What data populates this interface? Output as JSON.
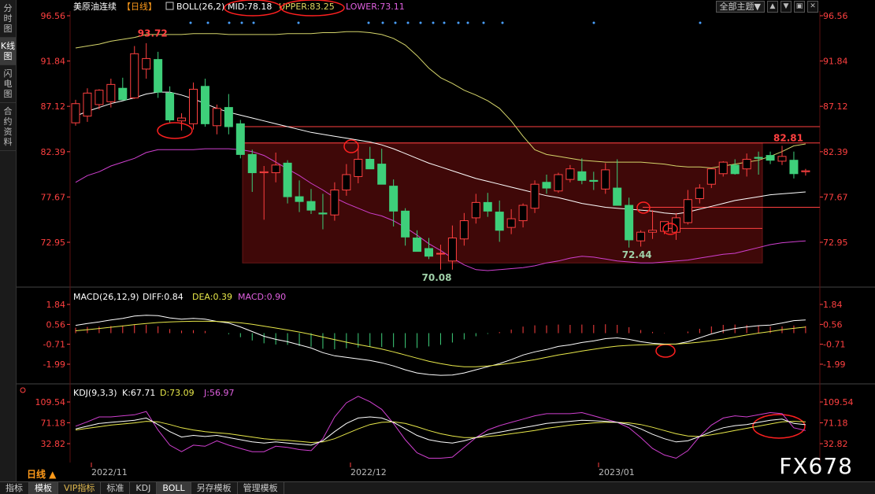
{
  "left_tabs": [
    "分时图",
    "K线图",
    "闪电图",
    "合约资料"
  ],
  "left_tab_active": 1,
  "main_header": {
    "symbol": "美原油连续",
    "period": "【日线】",
    "boll": "BOLL(26,2)",
    "mid": "MID:78.18",
    "upper": "UPPER:83.25",
    "lower": "LOWER:73.11"
  },
  "theme_select": "全部主题▼",
  "window_buttons": [
    "▲",
    "▼",
    "▣",
    "✕"
  ],
  "macd_header": {
    "name": "MACD(26,12,9)",
    "diff": "DIFF:0.84",
    "dea": "DEA:0.39",
    "macd": "MACD:0.90"
  },
  "kdj_header": {
    "name": "KDJ(9,3,3)",
    "k": "K:67.71",
    "d": "D:73.09",
    "j": "J:56.97"
  },
  "period_label": "日线 ▲",
  "bottom_tabs": [
    "指标",
    "模板",
    "VIP指标",
    "标准",
    "KDJ",
    "BOLL",
    "另存模板",
    "管理模板"
  ],
  "bottom_tab_active": [
    1,
    5
  ],
  "watermark": "FX678",
  "colors": {
    "up": "#ff4040",
    "down": "#3ecf7a",
    "mid": "#ffffff",
    "upper": "#d4d46a",
    "lower": "#d040d0",
    "diff": "#ffffff",
    "dea": "#e8e84a",
    "k": "#ffffff",
    "d": "#e8e84a",
    "j": "#d040d0",
    "axis": "#ff4040",
    "header_red": "#ff4040",
    "box": "#4a0a0a"
  },
  "chart_data": [
    {
      "type": "candlestick",
      "name": "price",
      "y_ticks": [
        96.56,
        91.84,
        87.12,
        82.39,
        77.67,
        72.95
      ],
      "x_labels": [
        "2022/11",
        "2022/12",
        "2023/01"
      ],
      "annotations": [
        {
          "label": "93.72",
          "index": 5,
          "value": 93.72,
          "pos": "high"
        },
        {
          "label": "70.08",
          "index": 29,
          "value": 70.08,
          "pos": "low"
        },
        {
          "label": "72.44",
          "index": 46,
          "value": 72.44,
          "pos": "low"
        },
        {
          "label": "82.81",
          "index": 59,
          "value": 82.81,
          "pos": "high"
        }
      ],
      "hlines": [
        85.0,
        83.3,
        76.6,
        74.4
      ],
      "ohlc": [
        [
          85.4,
          87.8,
          85.1,
          87.4
        ],
        [
          86.1,
          89.0,
          85.5,
          88.5
        ],
        [
          87.3,
          88.9,
          86.8,
          88.8
        ],
        [
          87.6,
          90.0,
          87.0,
          89.4
        ],
        [
          89.0,
          90.1,
          88.0,
          87.8
        ],
        [
          88.0,
          93.4,
          87.9,
          92.6
        ],
        [
          91.0,
          93.7,
          90.0,
          92.1
        ],
        [
          92.0,
          92.8,
          88.0,
          88.6
        ],
        [
          88.5,
          89.2,
          85.4,
          85.7
        ],
        [
          85.6,
          86.4,
          84.6,
          85.9
        ],
        [
          85.3,
          89.6,
          84.7,
          88.9
        ],
        [
          89.2,
          90.0,
          85.0,
          85.3
        ],
        [
          85.1,
          87.3,
          84.2,
          86.9
        ],
        [
          87.0,
          88.4,
          84.2,
          85.0
        ],
        [
          85.3,
          85.7,
          81.7,
          82.1
        ],
        [
          82.1,
          82.6,
          78.2,
          80.2
        ],
        [
          80.2,
          80.9,
          75.3,
          80.3
        ],
        [
          80.2,
          82.3,
          79.2,
          81.0
        ],
        [
          81.2,
          81.5,
          77.0,
          77.7
        ],
        [
          77.7,
          79.4,
          76.1,
          77.2
        ],
        [
          77.2,
          78.5,
          75.9,
          76.3
        ],
        [
          76.0,
          78.0,
          74.3,
          75.9
        ],
        [
          75.8,
          79.2,
          75.2,
          78.4
        ],
        [
          78.4,
          81.1,
          77.8,
          80.0
        ],
        [
          79.8,
          82.8,
          79.1,
          81.6
        ],
        [
          81.6,
          82.9,
          80.7,
          80.6
        ],
        [
          81.1,
          82.7,
          79.0,
          79.0
        ],
        [
          78.8,
          79.5,
          74.6,
          76.2
        ],
        [
          76.2,
          76.5,
          72.6,
          73.5
        ],
        [
          73.4,
          74.2,
          72.0,
          72.0
        ],
        [
          72.3,
          73.4,
          71.2,
          71.5
        ],
        [
          71.8,
          72.7,
          70.1,
          71.8
        ],
        [
          71.0,
          74.7,
          70.1,
          73.4
        ],
        [
          73.3,
          76.0,
          72.6,
          75.2
        ],
        [
          75.5,
          78.0,
          74.9,
          77.1
        ],
        [
          77.1,
          78.1,
          75.6,
          76.2
        ],
        [
          76.1,
          77.3,
          73.0,
          74.2
        ],
        [
          74.5,
          76.4,
          73.8,
          75.4
        ],
        [
          75.2,
          77.0,
          74.5,
          76.8
        ],
        [
          76.5,
          79.4,
          76.0,
          79.0
        ],
        [
          79.2,
          80.0,
          78.0,
          78.6
        ],
        [
          78.3,
          80.2,
          78.1,
          80.0
        ],
        [
          79.5,
          81.0,
          79.2,
          80.6
        ],
        [
          80.3,
          81.7,
          79.0,
          79.4
        ],
        [
          79.4,
          80.3,
          78.4,
          79.3
        ],
        [
          78.5,
          81.2,
          78.0,
          80.5
        ],
        [
          78.6,
          81.6,
          78.0,
          76.8
        ],
        [
          76.8,
          77.6,
          72.4,
          73.2
        ],
        [
          73.1,
          74.2,
          72.5,
          74.0
        ],
        [
          74.0,
          76.3,
          73.3,
          74.2
        ],
        [
          74.1,
          75.0,
          73.8,
          75.1
        ],
        [
          74.0,
          76.0,
          73.2,
          75.5
        ],
        [
          75.0,
          78.4,
          74.8,
          77.4
        ],
        [
          77.5,
          79.0,
          77.0,
          78.6
        ],
        [
          79.0,
          80.0,
          78.6,
          80.6
        ],
        [
          80.1,
          81.4,
          79.8,
          81.3
        ],
        [
          81.0,
          81.6,
          80.0,
          80.1
        ],
        [
          80.6,
          82.2,
          79.8,
          81.6
        ],
        [
          81.8,
          82.4,
          80.0,
          81.7
        ],
        [
          82.0,
          82.4,
          81.1,
          81.5
        ],
        [
          81.4,
          83.0,
          81.0,
          81.9
        ],
        [
          81.5,
          82.4,
          79.6,
          80.1
        ],
        [
          80.3,
          80.6,
          79.9,
          80.4
        ]
      ],
      "mid": [
        86.1,
        86.6,
        87.0,
        87.4,
        87.7,
        88.0,
        88.4,
        88.6,
        88.6,
        88.3,
        87.9,
        87.4,
        86.9,
        86.5,
        86.2,
        85.9,
        85.6,
        85.3,
        85.0,
        84.7,
        84.4,
        84.2,
        84.0,
        83.8,
        83.6,
        83.4,
        83.1,
        82.7,
        82.2,
        81.7,
        81.2,
        80.8,
        80.4,
        80.0,
        79.6,
        79.3,
        79.0,
        78.7,
        78.4,
        78.1,
        77.8,
        77.6,
        77.3,
        77.0,
        76.8,
        76.6,
        76.5,
        76.4,
        76.3,
        76.2,
        76.0,
        75.9,
        76.1,
        76.4,
        76.7,
        77.0,
        77.3,
        77.5,
        77.7,
        77.9,
        78.0,
        78.1,
        78.2
      ],
      "upper": [
        93.2,
        93.4,
        93.6,
        93.9,
        94.1,
        94.3,
        94.6,
        94.6,
        94.6,
        94.6,
        94.7,
        94.7,
        94.7,
        94.6,
        94.6,
        94.6,
        94.6,
        94.6,
        94.7,
        94.7,
        94.7,
        94.8,
        94.8,
        94.9,
        94.9,
        94.8,
        94.6,
        94.2,
        93.5,
        92.4,
        91.1,
        90.1,
        89.5,
        88.8,
        88.3,
        87.7,
        86.9,
        85.6,
        84.0,
        82.6,
        82.1,
        81.9,
        81.7,
        81.5,
        81.4,
        81.3,
        81.3,
        81.3,
        81.3,
        81.2,
        81.1,
        80.9,
        80.8,
        80.8,
        80.7,
        80.9,
        81.1,
        81.3,
        81.5,
        81.9,
        82.4,
        83.0,
        83.2
      ],
      "lower": [
        79.2,
        79.9,
        80.3,
        80.9,
        81.3,
        81.7,
        82.3,
        82.6,
        82.6,
        82.6,
        82.6,
        82.7,
        82.7,
        82.7,
        82.6,
        82.4,
        82.0,
        81.3,
        80.6,
        79.9,
        79.1,
        78.4,
        77.6,
        77.0,
        76.5,
        76.0,
        75.7,
        75.2,
        74.5,
        73.7,
        72.8,
        72.1,
        71.3,
        70.6,
        70.1,
        70.0,
        70.1,
        70.2,
        70.3,
        70.5,
        70.8,
        71.0,
        71.3,
        71.5,
        71.4,
        71.2,
        71.0,
        70.9,
        70.8,
        70.8,
        70.9,
        71.0,
        71.1,
        71.3,
        71.5,
        71.7,
        71.8,
        72.1,
        72.4,
        72.7,
        72.9,
        73.0,
        73.1
      ]
    },
    {
      "type": "macd",
      "name": "MACD(26,12,9)",
      "y_ticks": [
        1.84,
        0.56,
        -0.71,
        -1.99
      ],
      "diff": [
        0.5,
        0.62,
        0.72,
        0.84,
        0.95,
        1.1,
        1.15,
        1.12,
        0.98,
        0.9,
        0.95,
        0.9,
        0.75,
        0.65,
        0.4,
        0.1,
        -0.2,
        -0.4,
        -0.55,
        -0.75,
        -0.95,
        -1.25,
        -1.45,
        -1.55,
        -1.65,
        -1.75,
        -1.9,
        -2.1,
        -2.35,
        -2.55,
        -2.65,
        -2.7,
        -2.68,
        -2.55,
        -2.35,
        -2.15,
        -1.95,
        -1.7,
        -1.4,
        -1.2,
        -1.05,
        -0.85,
        -0.75,
        -0.6,
        -0.5,
        -0.35,
        -0.3,
        -0.4,
        -0.55,
        -0.65,
        -0.7,
        -0.7,
        -0.55,
        -0.3,
        -0.05,
        0.15,
        0.3,
        0.4,
        0.48,
        0.52,
        0.65,
        0.8,
        0.84
      ],
      "dea": [
        0.15,
        0.22,
        0.3,
        0.38,
        0.46,
        0.55,
        0.62,
        0.68,
        0.72,
        0.74,
        0.76,
        0.76,
        0.75,
        0.72,
        0.66,
        0.57,
        0.45,
        0.33,
        0.2,
        0.07,
        -0.08,
        -0.25,
        -0.42,
        -0.58,
        -0.73,
        -0.87,
        -1.02,
        -1.2,
        -1.4,
        -1.6,
        -1.8,
        -1.95,
        -2.08,
        -2.15,
        -2.15,
        -2.1,
        -2.02,
        -1.93,
        -1.82,
        -1.7,
        -1.55,
        -1.4,
        -1.28,
        -1.15,
        -1.03,
        -0.92,
        -0.83,
        -0.78,
        -0.75,
        -0.73,
        -0.72,
        -0.7,
        -0.65,
        -0.58,
        -0.48,
        -0.38,
        -0.25,
        -0.12,
        0.0,
        0.1,
        0.22,
        0.31,
        0.39
      ],
      "hist": [
        0.35,
        0.4,
        0.42,
        0.46,
        0.49,
        0.55,
        0.53,
        0.44,
        0.26,
        0.16,
        0.19,
        0.14,
        0.0,
        -0.07,
        -0.26,
        -0.47,
        -0.65,
        -0.73,
        -0.75,
        -0.82,
        -0.87,
        -1.0,
        -1.03,
        -0.97,
        -0.92,
        -0.88,
        -0.88,
        -0.9,
        -0.95,
        -0.95,
        -0.85,
        -0.75,
        -0.6,
        -0.4,
        -0.2,
        -0.05,
        0.07,
        0.23,
        0.42,
        0.5,
        0.5,
        0.55,
        0.53,
        0.55,
        0.53,
        0.57,
        0.53,
        0.38,
        0.2,
        0.08,
        0.02,
        0.0,
        0.1,
        0.28,
        0.43,
        0.53,
        0.55,
        0.52,
        0.48,
        0.42,
        0.43,
        0.49,
        0.45
      ]
    },
    {
      "type": "kdj",
      "name": "KDJ(9,3,3)",
      "y_ticks": [
        109.54,
        71.18,
        32.82
      ],
      "k": [
        60,
        65,
        70,
        72,
        74,
        76,
        80,
        68,
        55,
        45,
        48,
        46,
        48,
        44,
        40,
        36,
        34,
        36,
        34,
        32,
        30,
        38,
        55,
        70,
        80,
        82,
        80,
        72,
        60,
        48,
        40,
        36,
        34,
        38,
        44,
        50,
        54,
        58,
        62,
        66,
        70,
        72,
        74,
        76,
        75,
        74,
        72,
        68,
        60,
        50,
        42,
        36,
        38,
        46,
        55,
        62,
        66,
        68,
        72,
        76,
        78,
        70,
        67.71
      ],
      "d": [
        58,
        61,
        64,
        67,
        69,
        71,
        74,
        73,
        68,
        62,
        58,
        55,
        53,
        51,
        48,
        45,
        42,
        40,
        39,
        37,
        35,
        36,
        42,
        51,
        60,
        68,
        72,
        73,
        70,
        64,
        57,
        51,
        47,
        44,
        44,
        46,
        48,
        51,
        54,
        57,
        61,
        64,
        67,
        69,
        71,
        72,
        72,
        71,
        68,
        63,
        57,
        51,
        47,
        46,
        49,
        53,
        57,
        61,
        65,
        69,
        73,
        74,
        73.09
      ],
      "j": [
        65,
        73,
        82,
        82,
        84,
        86,
        92,
        58,
        30,
        18,
        30,
        28,
        38,
        30,
        24,
        18,
        18,
        28,
        26,
        22,
        20,
        42,
        82,
        108,
        120,
        110,
        96,
        70,
        40,
        16,
        6,
        6,
        8,
        26,
        44,
        58,
        66,
        72,
        78,
        84,
        88,
        88,
        88,
        90,
        84,
        78,
        72,
        62,
        44,
        24,
        12,
        6,
        20,
        46,
        67,
        80,
        84,
        82,
        86,
        90,
        88,
        62,
        56.97
      ]
    }
  ]
}
